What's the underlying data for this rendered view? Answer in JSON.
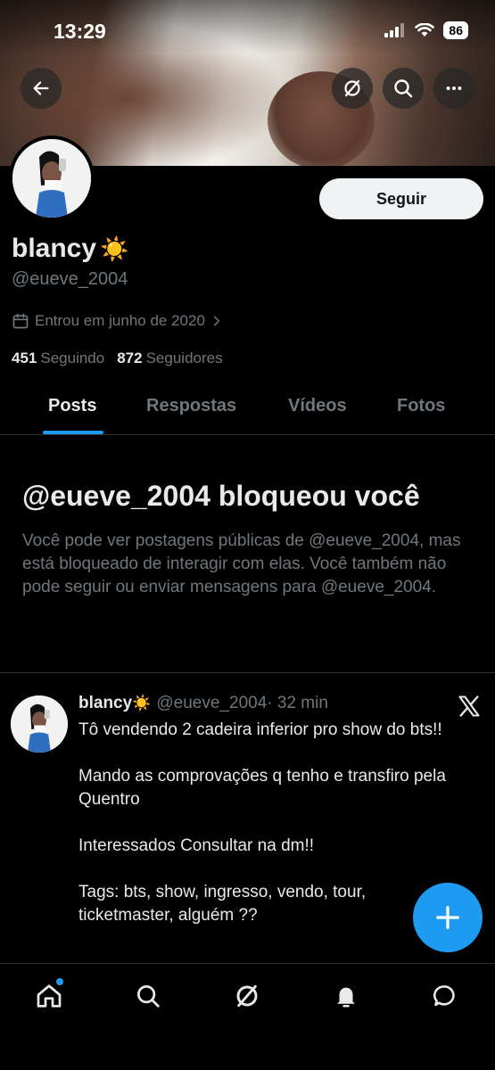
{
  "status_bar": {
    "time": "13:29",
    "battery": "86"
  },
  "profile": {
    "display_name": "blancy",
    "name_emoji": "☀️",
    "handle": "@eueve_2004",
    "joined": "Entrou em junho de 2020",
    "following_count": "451",
    "following_label": "Seguindo",
    "followers_count": "872",
    "followers_label": "Seguidores",
    "follow_button": "Seguir"
  },
  "tabs": [
    {
      "label": "Posts",
      "active": true
    },
    {
      "label": "Respostas",
      "active": false
    },
    {
      "label": "Vídeos",
      "active": false
    },
    {
      "label": "Fotos",
      "active": false
    }
  ],
  "blocked": {
    "title": "@eueve_2004 bloqueou você",
    "description": "Você pode ver postagens públicas de @eueve_2004, mas está bloqueado de interagir com elas. Você também não pode seguir ou enviar mensagens para @eueve_2004."
  },
  "tweet": {
    "name": "blancy",
    "emoji": "☀️",
    "handle": "@eueve_2004",
    "time": "· 32 min",
    "text": "Tô vendendo 2 cadeira inferior pro show do bts!!\n\nMando as comprovações q tenho e transfiro pela Quentro\n\nInteressados Consultar na dm!!\n\nTags: bts, show, ingresso, vendo, tour, ticketmaster, alguém ??"
  },
  "colors": {
    "accent": "#1d9bf0",
    "background": "#000000",
    "muted": "#71767b"
  },
  "icons": [
    "back-arrow-icon",
    "grok-icon",
    "search-icon",
    "more-icon",
    "calendar-icon",
    "chevron-right-icon",
    "x-logo-icon",
    "compose-plus-icon",
    "home-icon",
    "bell-icon",
    "messages-icon"
  ]
}
